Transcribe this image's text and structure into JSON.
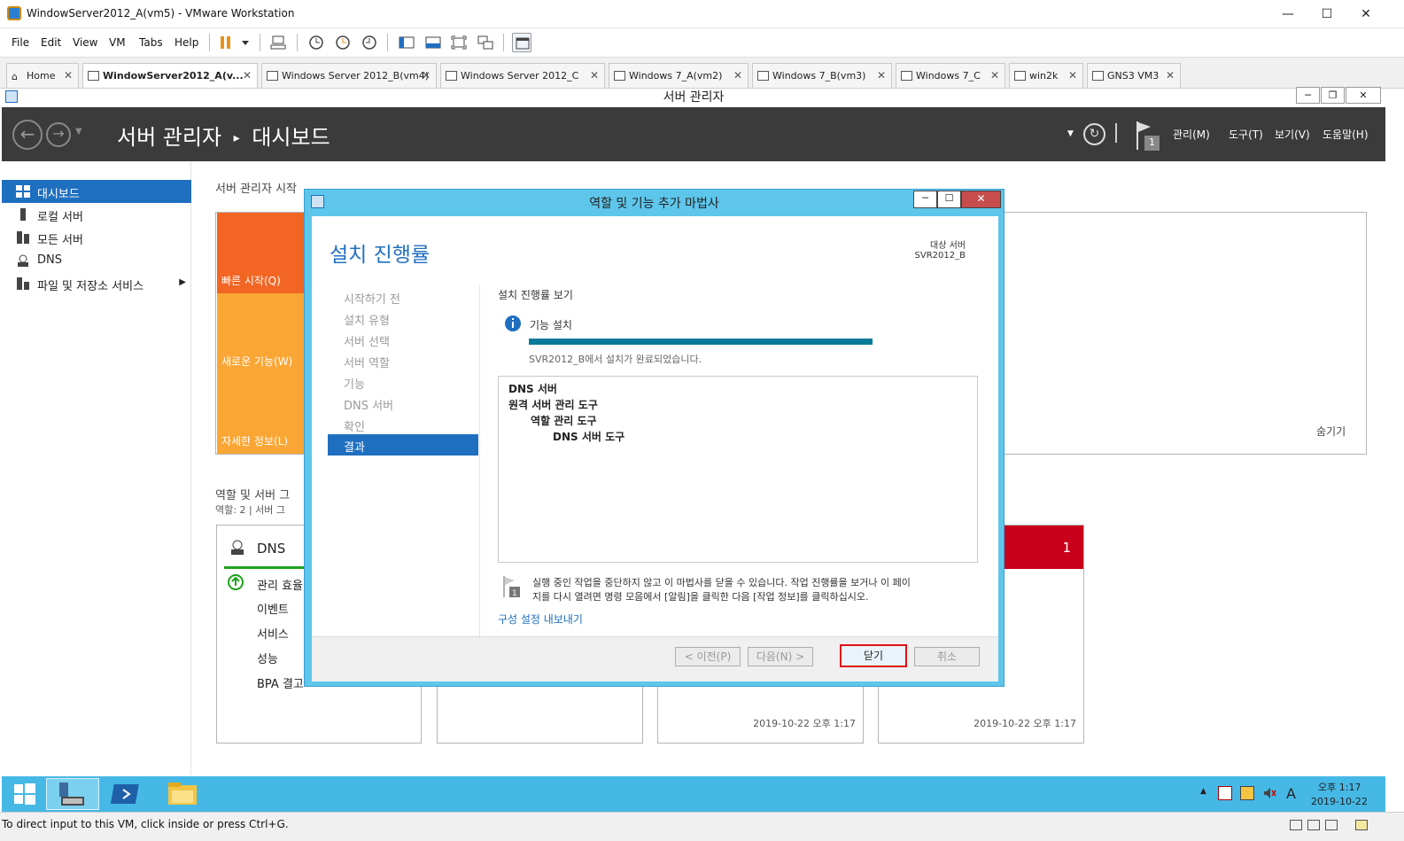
{
  "vmware": {
    "title": "WindowServer2012_A(vm5) - VMware Workstation",
    "menu": [
      "File",
      "Edit",
      "View",
      "VM",
      "Tabs",
      "Help"
    ],
    "tabs": [
      {
        "label": "Home"
      },
      {
        "label": "WindowServer2012_A(v..."
      },
      {
        "label": "Windows Server 2012_B(vm4)"
      },
      {
        "label": "Windows Server 2012_C"
      },
      {
        "label": "Windows 7_A(vm2)"
      },
      {
        "label": "Windows 7_B(vm3)"
      },
      {
        "label": "Windows 7_C"
      },
      {
        "label": "win2k"
      },
      {
        "label": "GNS3 VM3"
      }
    ],
    "status": "To direct input to this VM, click inside or press Ctrl+G."
  },
  "server_manager": {
    "window_title": "서버 관리자",
    "breadcrumb_root": "서버 관리자",
    "breadcrumb_page": "대시보드",
    "menus": [
      "관리(M)",
      "도구(T)",
      "보기(V)",
      "도움말(H)"
    ],
    "notification_count": "1",
    "sidebar": [
      {
        "label": "대시보드"
      },
      {
        "label": "로컬 서버"
      },
      {
        "label": "모든 서버"
      },
      {
        "label": "DNS"
      },
      {
        "label": "파일 및 저장소 서비스"
      }
    ],
    "welcome_title": "서버 관리자 시작",
    "tiles": [
      "빠른 시작(Q)",
      "새로운 기능(W)",
      "자세한 정보(L)"
    ],
    "hide": "숨기기",
    "roles_heading": "역할 및 서버 그",
    "roles_sub": "역할: 2 | 서버 그",
    "dns_card": {
      "title": "DNS",
      "items": [
        "관리 효율",
        "이벤트",
        "서비스",
        "성능",
        "BPA 결고"
      ]
    },
    "alert_count": "1",
    "timestamps": [
      "2019-10-22 오후 1:17",
      "2019-10-22 오후 1:17"
    ]
  },
  "wizard": {
    "title": "역할 및 기능 추가 마법사",
    "heading": "설치 진행률",
    "target_label": "대상 서버",
    "target_server": "SVR2012_B",
    "steps": [
      "시작하기 전",
      "설치 유형",
      "서버 선택",
      "서버 역할",
      "기능",
      "DNS 서버",
      "확인",
      "결과"
    ],
    "section_title": "설치 진행률 보기",
    "progress_label": "기능 설치",
    "progress_fraction": 1.0,
    "complete_message": "SVR2012_B에서 설치가 완료되었습니다.",
    "results": [
      "DNS 서버",
      "원격 서버 관리 도구",
      "역할 관리 도구",
      "DNS 서버 도구"
    ],
    "notice_line1": "실행 중인 작업을 중단하지 않고 이 마법사를 닫을 수 있습니다. 작업 진행률을 보거나 이 페이",
    "notice_line2": "지를 다시 열려면 명령 모음에서 [알림]을 클릭한 다음 [작업 정보]를 클릭하십시오.",
    "export_link": "구성 설정 내보내기",
    "buttons": {
      "prev": "< 이전(P)",
      "next": "다음(N) >",
      "close": "닫기",
      "cancel": "취소"
    }
  },
  "taskbar": {
    "time": "오후 1:17",
    "date": "2019-10-22"
  },
  "colors": {
    "accent": "#1f6fc0",
    "wizard_frame": "#5ec6eb",
    "alert": "#c8001c",
    "tile_orange": "#f26522",
    "tile_light": "#faa634"
  }
}
